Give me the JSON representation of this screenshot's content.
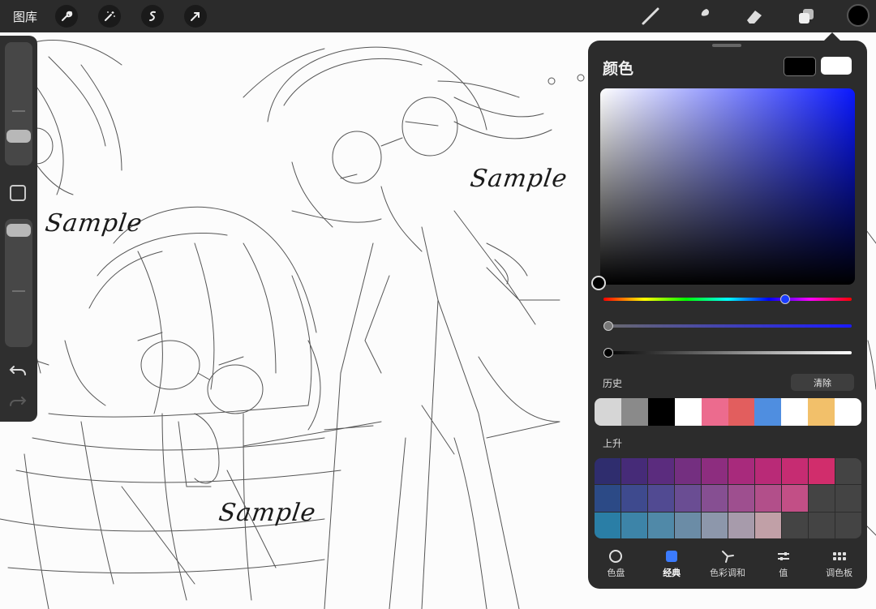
{
  "topbar": {
    "gallery_label": "图库",
    "left_tools": [
      "wrench-icon",
      "magic-wand-icon",
      "selection-icon",
      "transform-arrow-icon"
    ],
    "right_tools": [
      "brush-icon",
      "smudge-icon",
      "eraser-icon",
      "layers-icon"
    ],
    "current_color": "#000000"
  },
  "canvas": {
    "watermarks": [
      "Sample",
      "Sample",
      "Sample"
    ]
  },
  "sidebar": {
    "brush_size_level": 0.2,
    "opacity_level": 0.0,
    "buttons": [
      "square-modify-icon",
      "undo-icon",
      "redo-icon"
    ]
  },
  "color_panel": {
    "title": "颜色",
    "primary_color": "#000000",
    "secondary_color": "#ffffff",
    "hue_position": 0.73,
    "saturation_position": 0.02,
    "brightness_position": 0.02,
    "history_label": "历史",
    "clear_label": "清除",
    "history_colors": [
      "#d6d6d6",
      "#8a8a8a",
      "#000000",
      "#ffffff",
      "#ec6b8e",
      "#e25e5e",
      "#4f8ee0",
      "#ffffff",
      "#f2c06a",
      "#ffffff"
    ],
    "palette_label": "上升",
    "palette_colors": [
      "#2f2d6e",
      "#462b78",
      "#5b2c7e",
      "#742f80",
      "#8d2d7f",
      "#a82a7c",
      "#b92a77",
      "#c62c72",
      "#d12d6c",
      "#444444",
      "#2c4a86",
      "#3e4a8e",
      "#514a92",
      "#6a4d93",
      "#864f92",
      "#9e4f8f",
      "#b24f8a",
      "#c24f86",
      "#444444",
      "#444444",
      "#2a7ea6",
      "#3d84a8",
      "#5089a8",
      "#6b8ca6",
      "#8d97ab",
      "#a79bab",
      "#c1a0a7",
      "#444444",
      "#444444",
      "#444444"
    ],
    "tabs": [
      {
        "label": "色盘",
        "icon": "disc-icon"
      },
      {
        "label": "经典",
        "icon": "classic-square-icon",
        "active": true
      },
      {
        "label": "色彩调和",
        "icon": "harmony-icon"
      },
      {
        "label": "值",
        "icon": "sliders-icon"
      },
      {
        "label": "调色板",
        "icon": "palette-grid-icon"
      }
    ]
  }
}
